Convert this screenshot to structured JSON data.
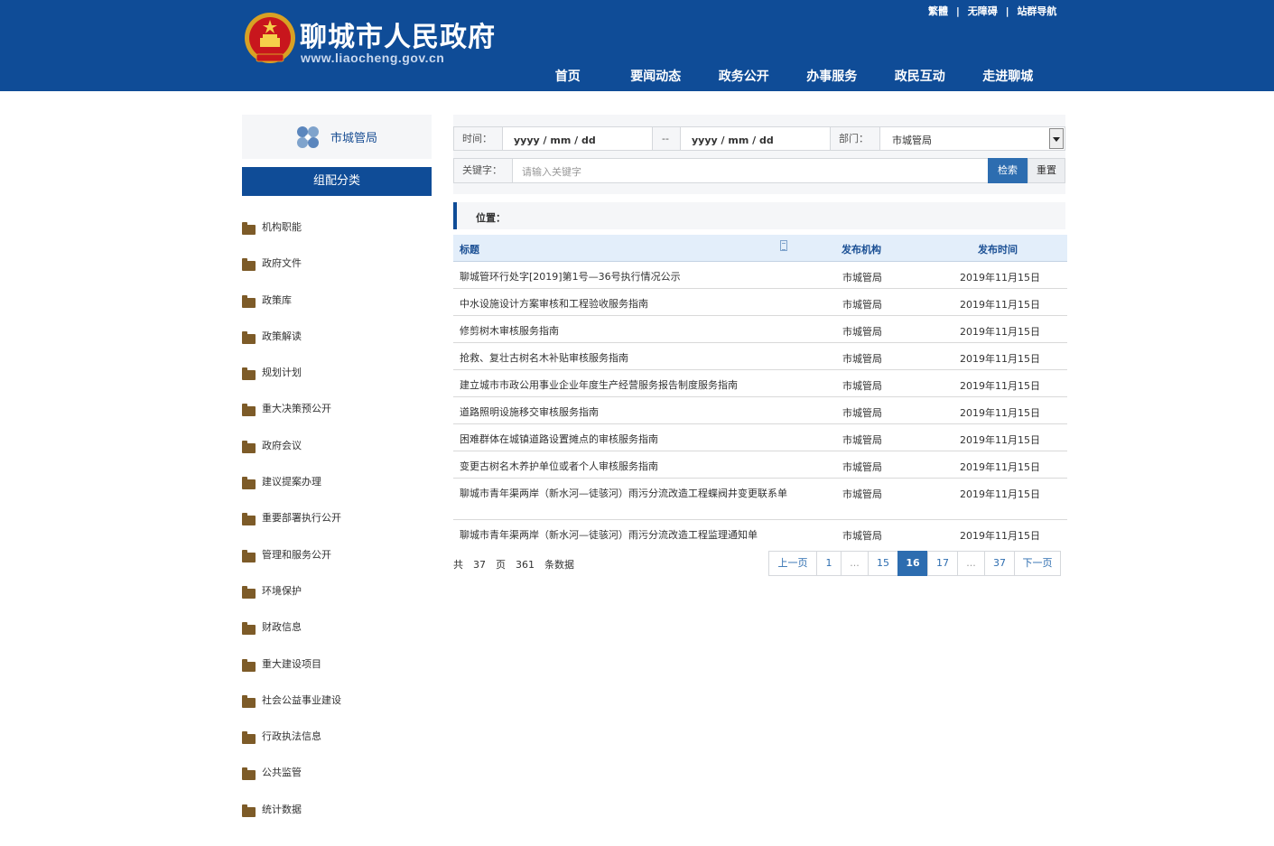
{
  "header": {
    "site_name": "聊城市人民政府",
    "site_url": "www.liaocheng.gov.cn",
    "toplinks": [
      "繁體",
      "无障碍",
      "站群导航"
    ],
    "toplink_sep": "|",
    "nav": [
      "首页",
      "要闻动态",
      "政务公开",
      "办事服务",
      "政民互动",
      "走进聊城"
    ],
    "brand_color": "#0f4c97"
  },
  "sidebar": {
    "dept_name": "市城管局",
    "category_header": "组配分类",
    "categories": [
      "机构职能",
      "政府文件",
      "政策库",
      "政策解读",
      "规划计划",
      "重大决策预公开",
      "政府会议",
      "建议提案办理",
      "重要部署执行公开",
      "管理和服务公开",
      "环境保护",
      "财政信息",
      "重大建设项目",
      "社会公益事业建设",
      "行政执法信息",
      "公共监管",
      "统计数据"
    ]
  },
  "search": {
    "time_label": "时间：",
    "date_from": "yyyy / mm / dd",
    "date_sep": "--",
    "date_to": "yyyy / mm / dd",
    "dept_label": "部门：",
    "dept_value": "市城管局",
    "keyword_label": "关键字：",
    "keyword_placeholder": "请输入关键字",
    "search_button": "检索",
    "reset_button": "重置"
  },
  "position": {
    "label": "位置："
  },
  "table": {
    "headers": {
      "title": "标题",
      "org": "发布机构",
      "date": "发布时间"
    },
    "rows": [
      {
        "title": "聊城管环行处字[2019]第1号—36号执行情况公示",
        "org": "市城管局",
        "date": "2019年11月15日"
      },
      {
        "title": "中水设施设计方案审核和工程验收服务指南",
        "org": "市城管局",
        "date": "2019年11月15日"
      },
      {
        "title": "修剪树木审核服务指南",
        "org": "市城管局",
        "date": "2019年11月15日"
      },
      {
        "title": "抢救、复壮古树名木补贴审核服务指南",
        "org": "市城管局",
        "date": "2019年11月15日"
      },
      {
        "title": "建立城市市政公用事业企业年度生产经营服务报告制度服务指南",
        "org": "市城管局",
        "date": "2019年11月15日"
      },
      {
        "title": "道路照明设施移交审核服务指南",
        "org": "市城管局",
        "date": "2019年11月15日"
      },
      {
        "title": "困难群体在城镇道路设置摊点的审核服务指南",
        "org": "市城管局",
        "date": "2019年11月15日"
      },
      {
        "title": "变更古树名木养护单位或者个人审核服务指南",
        "org": "市城管局",
        "date": "2019年11月15日"
      },
      {
        "title": "聊城市青年渠两岸（新水河—徒骇河）雨污分流改造工程蝶阀井变更联系单",
        "org": "市城管局",
        "date": "2019年11月15日"
      },
      {
        "title": "聊城市青年渠两岸（新水河—徒骇河）雨污分流改造工程监理通知单",
        "org": "市城管局",
        "date": "2019年11月15日"
      }
    ]
  },
  "pagination": {
    "total_prefix": "共",
    "total_pages": "37",
    "pages_unit": "页",
    "total_records": "361",
    "records_unit": "条数据",
    "prev": "上一页",
    "next": "下一页",
    "pages": [
      "1",
      "...",
      "15",
      "16",
      "17",
      "...",
      "37"
    ],
    "current": "16"
  }
}
